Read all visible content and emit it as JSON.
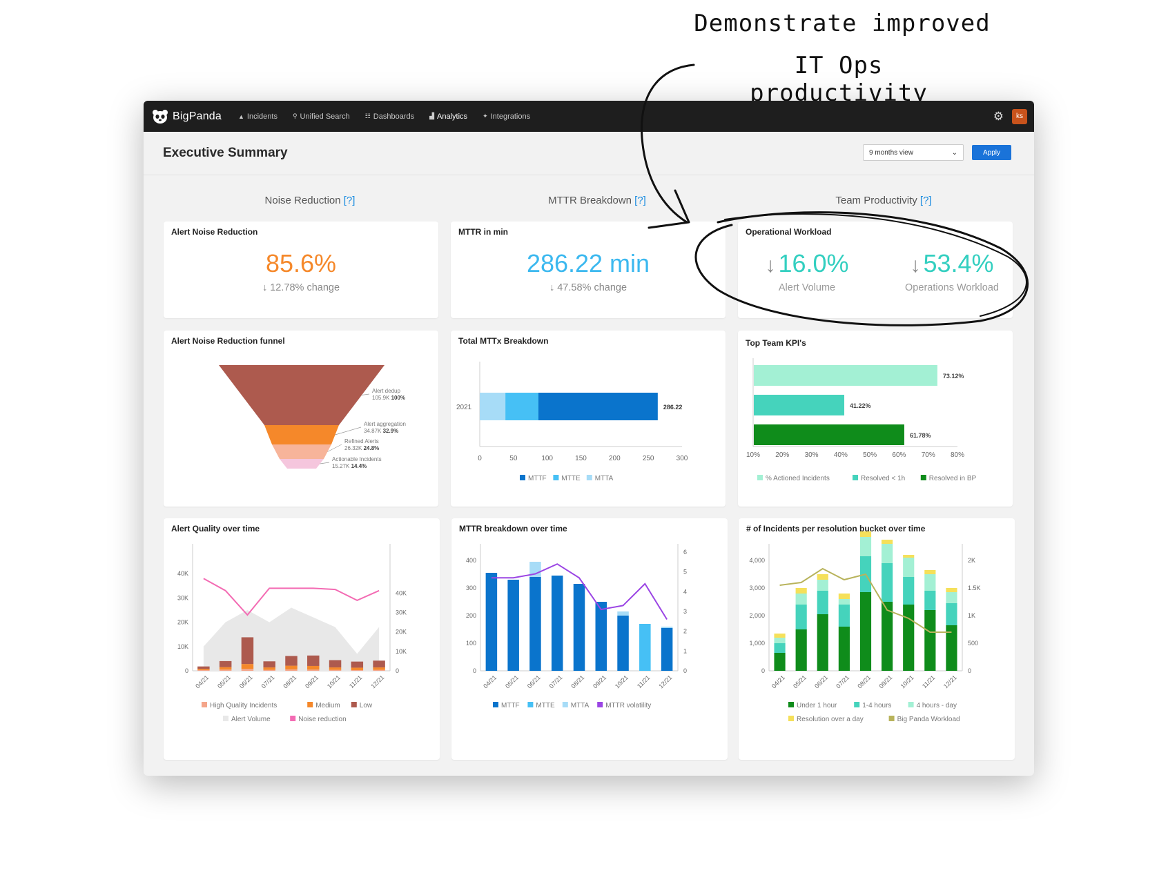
{
  "annotation": {
    "line1": "Demonstrate improved",
    "line2": "IT Ops productivity"
  },
  "nav": {
    "brand": "BigPanda",
    "items": [
      {
        "label": "Incidents",
        "icon": "bell-icon"
      },
      {
        "label": "Unified Search",
        "icon": "search-icon"
      },
      {
        "label": "Dashboards",
        "icon": "grid-icon"
      },
      {
        "label": "Analytics",
        "icon": "bar-chart-icon"
      },
      {
        "label": "Integrations",
        "icon": "plug-icon"
      }
    ],
    "active": "Analytics",
    "avatar": "ks"
  },
  "header": {
    "title": "Executive Summary",
    "view_select": "9 months view",
    "apply": "Apply"
  },
  "sections": {
    "noise": "Noise Reduction",
    "mttr": "MTTR Breakdown",
    "team": "Team Productivity",
    "help": "[?]"
  },
  "cards": {
    "alert_noise": {
      "title": "Alert Noise Reduction",
      "value": "85.6%",
      "change": "↓ 12.78% change"
    },
    "mttr_min": {
      "title": "MTTR in min",
      "value": "286.22 min",
      "change": "↓ 47.58% change"
    },
    "op_workload": {
      "title": "Operational Workload",
      "kpis": [
        {
          "value": "16.0%",
          "label": "Alert Volume"
        },
        {
          "value": "53.4%",
          "label": "Operations Workload"
        }
      ]
    },
    "funnel_title": "Alert Noise Reduction funnel",
    "mttx_title": "Total MTTx Breakdown",
    "team_kpi_title": "Top Team KPI's",
    "quality_title": "Alert Quality over time",
    "mttr_time_title": "MTTR breakdown over time",
    "buckets_title": "# of Incidents per resolution bucket over time"
  },
  "colors": {
    "orange": "#f5882a",
    "blue": "#3bb8ef",
    "teal": "#33cfc0",
    "accent": "#1a73d9"
  },
  "chart_data": [
    {
      "type": "funnel",
      "title": "Alert Noise Reduction funnel",
      "stages": [
        {
          "name": "Alert dedup",
          "value": "105.9K",
          "percent": "100%",
          "color": "#ad5a4e"
        },
        {
          "name": "Alert aggregation",
          "value": "34.87K",
          "percent": "32.9%",
          "color": "#f5882a"
        },
        {
          "name": "Refined Alerts",
          "value": "26.32K",
          "percent": "24.8%",
          "color": "#f7b49a"
        },
        {
          "name": "Actionable Incidents",
          "value": "15.27K",
          "percent": "14.4%",
          "color": "#f5c6dd"
        }
      ]
    },
    {
      "type": "bar",
      "orientation": "horizontal-stacked",
      "title": "Total MTTx Breakdown",
      "categories": [
        "2021"
      ],
      "series": [
        {
          "name": "MTTF",
          "values": [
            177
          ],
          "color": "#0a74cc"
        },
        {
          "name": "MTTE",
          "values": [
            49
          ],
          "color": "#46c0f5"
        },
        {
          "name": "MTTA",
          "values": [
            38
          ],
          "color": "#a7dcf7"
        }
      ],
      "total_label": "286.22",
      "xlim": [
        0,
        300
      ],
      "xticks": [
        "0",
        "50",
        "100",
        "150",
        "200",
        "250",
        "300"
      ]
    },
    {
      "type": "bar",
      "orientation": "horizontal",
      "title": "Top Team KPI's",
      "series": [
        {
          "name": "% Actioned Incidents",
          "value": 73.12,
          "label": "73.12%",
          "color": "#a3f0d4"
        },
        {
          "name": "Resolved < 1h",
          "value": 41.22,
          "label": "41.22%",
          "color": "#45d3bc"
        },
        {
          "name": "Resolved in BP",
          "value": 61.78,
          "label": "61.78%",
          "color": "#0f8c1b"
        }
      ],
      "xlim": [
        10,
        80
      ],
      "xticks": [
        "10%",
        "20%",
        "30%",
        "40%",
        "50%",
        "60%",
        "70%",
        "80%"
      ]
    },
    {
      "type": "bar",
      "title": "Alert Quality over time",
      "categories": [
        "04/21",
        "05/21",
        "06/21",
        "07/21",
        "08/21",
        "09/21",
        "10/21",
        "11/21",
        "12/21"
      ],
      "series": [
        {
          "name": "High Quality Incidents",
          "values": [
            300,
            500,
            800,
            400,
            600,
            500,
            400,
            300,
            400
          ],
          "color": "#f4a58a"
        },
        {
          "name": "Medium",
          "values": [
            500,
            1000,
            2000,
            1000,
            1500,
            1500,
            1000,
            1000,
            1000
          ],
          "color": "#f5882a"
        },
        {
          "name": "Low",
          "values": [
            1000,
            2500,
            11000,
            2500,
            4000,
            4300,
            3000,
            2500,
            2800
          ],
          "color": "#ad5a4e"
        },
        {
          "name": "Alert Volume",
          "type": "area",
          "values": [
            10000,
            20000,
            25000,
            20000,
            26000,
            22000,
            18000,
            7000,
            18000
          ],
          "color": "#e8e8e8"
        },
        {
          "name": "Noise reduction",
          "type": "line",
          "values": [
            38000,
            33000,
            23000,
            34000,
            34000,
            34000,
            33500,
            29000,
            33000
          ],
          "color": "#f36bb3"
        }
      ],
      "ylim": [
        0,
        50000
      ],
      "yticks": [
        "0",
        "10K",
        "20K",
        "30K",
        "40K"
      ],
      "yticks_right": [
        "0",
        "10K",
        "20K",
        "30K",
        "40K"
      ]
    },
    {
      "type": "bar",
      "title": "MTTR breakdown over time",
      "categories": [
        "04/21",
        "05/21",
        "06/21",
        "07/21",
        "08/21",
        "09/21",
        "10/21",
        "11/21",
        "12/21"
      ],
      "series": [
        {
          "name": "MTTF",
          "values": [
            355,
            330,
            340,
            345,
            315,
            250,
            200,
            0,
            155
          ],
          "color": "#0a74cc"
        },
        {
          "name": "MTTE",
          "values": [
            0,
            0,
            0,
            0,
            0,
            0,
            0,
            170,
            0
          ],
          "color": "#46c0f5"
        },
        {
          "name": "MTTA",
          "values": [
            0,
            0,
            55,
            0,
            0,
            0,
            15,
            0,
            5
          ],
          "color": "#a7dcf7"
        },
        {
          "name": "MTTR volatility",
          "type": "line",
          "axis": "right",
          "values": [
            4.7,
            4.7,
            4.9,
            5.4,
            4.7,
            3.1,
            3.3,
            4.4,
            2.6
          ],
          "color": "#9b45e4"
        }
      ],
      "ylim": [
        0,
        440
      ],
      "yticks": [
        "0",
        "100",
        "200",
        "300",
        "400"
      ],
      "yticks_right": [
        "0",
        "1",
        "2",
        "3",
        "4",
        "5",
        "6"
      ]
    },
    {
      "type": "bar",
      "title": "# of Incidents per resolution bucket over time",
      "categories": [
        "04/21",
        "05/21",
        "06/21",
        "07/21",
        "08/21",
        "09/21",
        "10/21",
        "11/21",
        "12/21"
      ],
      "series": [
        {
          "name": "Under 1 hour",
          "values": [
            650,
            1500,
            2050,
            1600,
            2850,
            2500,
            2400,
            2200,
            1650
          ],
          "color": "#0f8c1b"
        },
        {
          "name": "1-4 hours",
          "values": [
            350,
            900,
            850,
            800,
            1300,
            1400,
            1000,
            700,
            800
          ],
          "color": "#45d3bc"
        },
        {
          "name": "4 hours - day",
          "values": [
            200,
            400,
            400,
            200,
            700,
            700,
            700,
            600,
            400
          ],
          "color": "#a3f0d4"
        },
        {
          "name": "Resolution over a day",
          "values": [
            150,
            200,
            200,
            200,
            200,
            150,
            100,
            150,
            150
          ],
          "color": "#f5e05a"
        },
        {
          "name": "Big Panda Workload",
          "type": "line",
          "axis": "right",
          "values": [
            1550,
            1600,
            1850,
            1650,
            1750,
            1100,
            950,
            700,
            700
          ],
          "color": "#b8b35b"
        }
      ],
      "ylim": [
        0,
        4400
      ],
      "yticks": [
        "0",
        "1,000",
        "2,000",
        "3,000",
        "4,000"
      ],
      "yticks_right": [
        "0",
        "500",
        "1K",
        "1.5K",
        "2K"
      ]
    }
  ]
}
